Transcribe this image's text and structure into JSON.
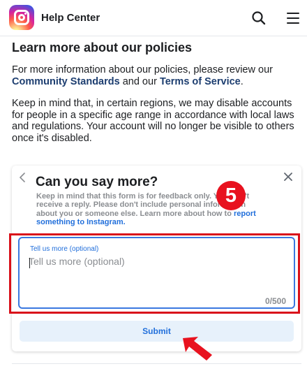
{
  "header": {
    "title": "Help Center",
    "logo_icon": "instagram-logo",
    "search_icon": "search-icon",
    "menu_icon": "hamburger-menu-icon"
  },
  "content": {
    "heading": "Learn more about our policies",
    "p1_prefix": "For more information about our policies, please review our ",
    "community_standards": "Community Standards",
    "p1_mid": " and our ",
    "terms_of_service": "Terms of Service",
    "p1_suffix": ".",
    "p2": "Keep in mind that, in certain regions, we may disable accounts for people in a specific age range in accordance with local laws and regulations. Your account will no longer be visible to others once it's disabled."
  },
  "feedback": {
    "title": "Can you say more?",
    "note_prefix": "Keep in mind that this form is for feedback only. You won't receive a reply. Please don't include personal information about you or someone else. Learn more about how to ",
    "note_link": "report something to Instagram.",
    "textarea_label": "Tell us more (optional)",
    "textarea_placeholder": "Tell us more (optional)",
    "textarea_value": "",
    "char_count": "0/500",
    "submit_label": "Submit",
    "step_number": "5"
  },
  "colors": {
    "link_dark": "#1d3e70",
    "link_blue": "#216fdb",
    "highlight_red": "#d9101a",
    "badge_red": "#e8121f",
    "submit_bg": "#e7f1fb"
  }
}
